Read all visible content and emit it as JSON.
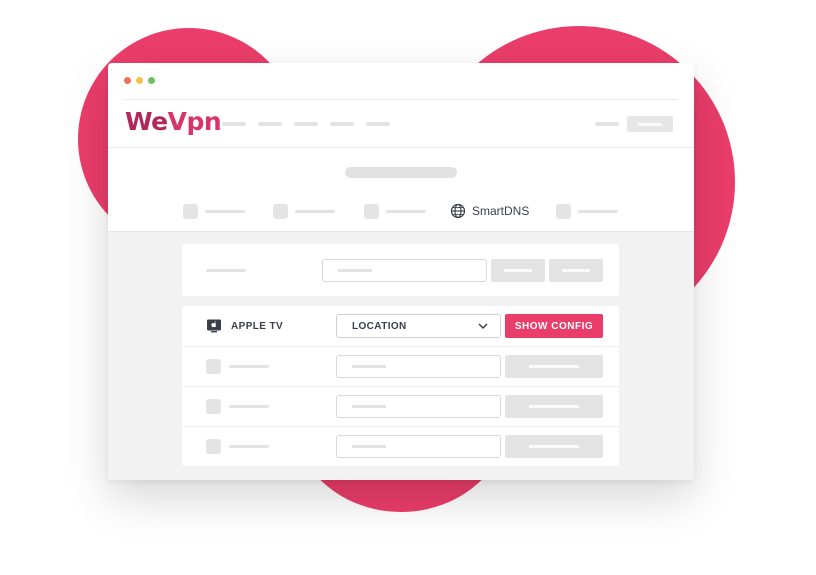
{
  "brand": {
    "logo_part1": "We",
    "logo_part2": "Vpn",
    "color_primary": "#ea3d6a",
    "color_logo": "#b0285c"
  },
  "window": {
    "traffic_lights": [
      "#f0715b",
      "#f2c34a",
      "#6ec15f"
    ]
  },
  "tabs": {
    "active_label": "SmartDNS",
    "active_icon": "globe-icon"
  },
  "devices": {
    "primary": {
      "label": "APPLE TV",
      "icon": "apple-tv-icon",
      "location_select": "LOCATION",
      "action_label": "SHOW CONFIG"
    }
  }
}
